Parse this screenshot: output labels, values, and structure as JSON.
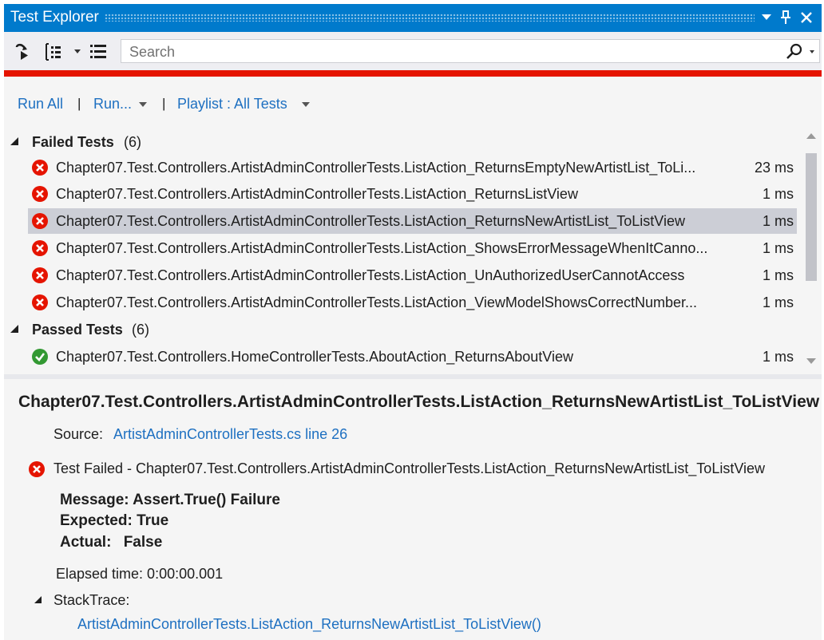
{
  "window": {
    "title": "Test Explorer",
    "buttons": {
      "dropdown": "▼",
      "pin": "ㅍ",
      "close": "✕"
    }
  },
  "toolbar": {
    "icons": [
      "run-tests-after-build-icon",
      "group-by-icon",
      "playlist-icon"
    ],
    "search": {
      "placeholder": "Search",
      "value": ""
    },
    "status_bar_color": "#e51400"
  },
  "commands": {
    "run_all": "Run All",
    "run": "Run...",
    "playlist": "Playlist : All Tests"
  },
  "groups": [
    {
      "title": "Failed Tests",
      "count": "(6)",
      "tests": [
        {
          "name": "Chapter07.Test.Controllers.ArtistAdminControllerTests.ListAction_ReturnsEmptyNewArtistList_ToLi...",
          "duration": "23 ms",
          "status": "failed"
        },
        {
          "name": "Chapter07.Test.Controllers.ArtistAdminControllerTests.ListAction_ReturnsListView",
          "duration": "1 ms",
          "status": "failed"
        },
        {
          "name": "Chapter07.Test.Controllers.ArtistAdminControllerTests.ListAction_ReturnsNewArtistList_ToListView",
          "duration": "1 ms",
          "status": "failed",
          "selected": true
        },
        {
          "name": "Chapter07.Test.Controllers.ArtistAdminControllerTests.ListAction_ShowsErrorMessageWhenItCanno...",
          "duration": "1 ms",
          "status": "failed"
        },
        {
          "name": "Chapter07.Test.Controllers.ArtistAdminControllerTests.ListAction_UnAuthorizedUserCannotAccess",
          "duration": "1 ms",
          "status": "failed"
        },
        {
          "name": "Chapter07.Test.Controllers.ArtistAdminControllerTests.ListAction_ViewModelShowsCorrectNumber...",
          "duration": "1 ms",
          "status": "failed"
        }
      ]
    },
    {
      "title": "Passed Tests",
      "count": "(6)",
      "tests": [
        {
          "name": "Chapter07.Test.Controllers.HomeControllerTests.AboutAction_ReturnsAboutView",
          "duration": "1 ms",
          "status": "passed"
        }
      ]
    }
  ],
  "detail": {
    "title": "Chapter07.Test.Controllers.ArtistAdminControllerTests.ListAction_ReturnsNewArtistList_ToListView",
    "source_label": "Source:",
    "source_link": "ArtistAdminControllerTests.cs line 26",
    "result": "Test Failed - Chapter07.Test.Controllers.ArtistAdminControllerTests.ListAction_ReturnsNewArtistList_ToListView",
    "message": "Message: Assert.True() Failure",
    "expected": "Expected: True",
    "actual_label": "Actual:",
    "actual_value": "False",
    "elapsed": "Elapsed time: 0:00:00.001",
    "stacktrace_label": "StackTrace:",
    "stacktrace_link": "ArtistAdminControllerTests.ListAction_ReturnsNewArtistList_ToListView()"
  },
  "colors": {
    "title_bar": "#007acc",
    "link": "#1e70c1",
    "failed": "#e51400",
    "passed": "#339933",
    "selected_row": "#ccced6"
  }
}
